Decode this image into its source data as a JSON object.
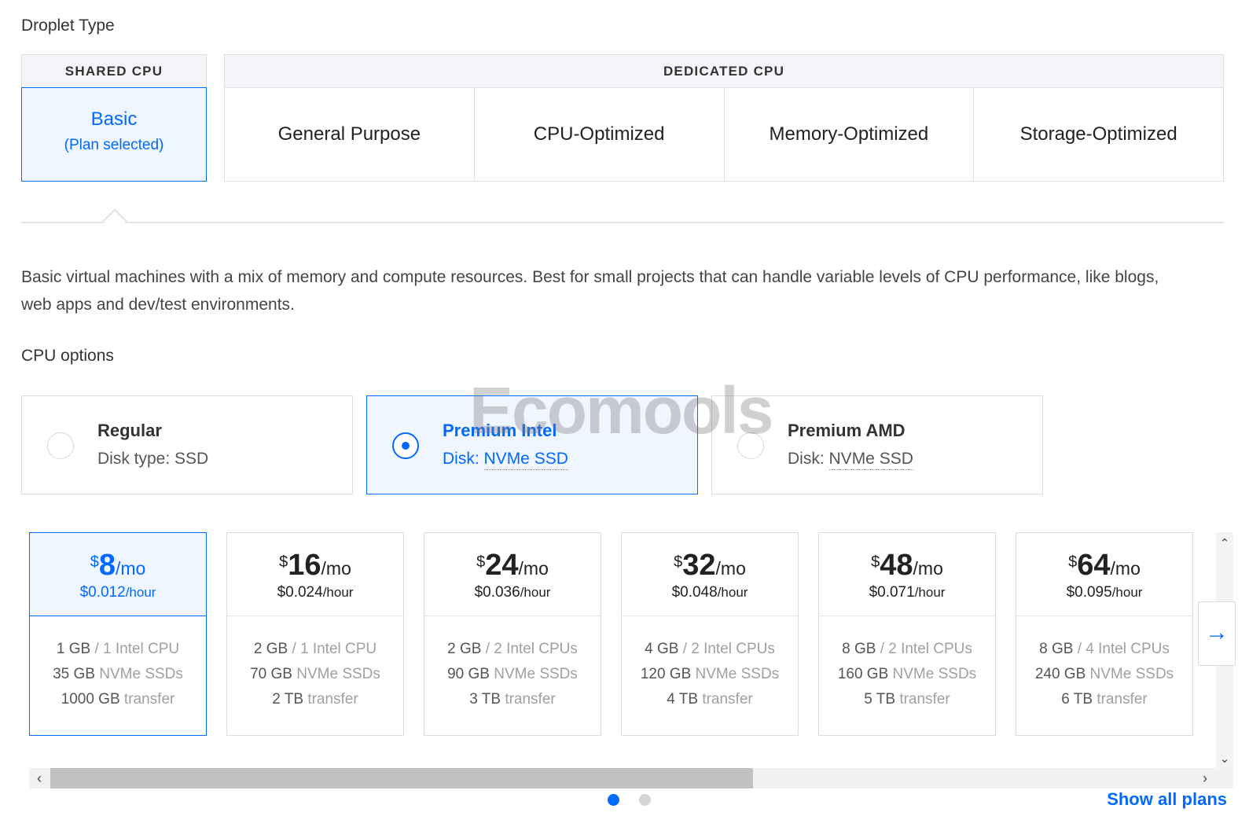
{
  "droplet_type": {
    "title": "Droplet Type",
    "shared": {
      "header": "SHARED CPU",
      "basic": {
        "name": "Basic",
        "status": "(Plan selected)"
      }
    },
    "dedicated": {
      "header": "DEDICATED CPU",
      "items": [
        "General Purpose",
        "CPU-Optimized",
        "Memory-Optimized",
        "Storage-Optimized"
      ]
    }
  },
  "description": "Basic virtual machines with a mix of memory and compute resources. Best for small projects that can handle variable levels of CPU performance, like blogs, web apps and dev/test environments.",
  "cpu_options": {
    "title": "CPU options",
    "items": [
      {
        "name": "Regular",
        "disk_label": "Disk type:",
        "disk_value": "SSD",
        "selected": false
      },
      {
        "name": "Premium Intel",
        "disk_label": "Disk:",
        "disk_value": "NVMe SSD",
        "selected": true
      },
      {
        "name": "Premium AMD",
        "disk_label": "Disk:",
        "disk_value": "NVMe SSD",
        "selected": false
      }
    ]
  },
  "watermark": "Ecomools",
  "plans": [
    {
      "currency": "$",
      "amount": "8",
      "per": "/mo",
      "hourly": "$0.012",
      "hourly_unit": "/hour",
      "mem": "1 GB",
      "cpu": "/ 1 Intel CPU",
      "disk": "35 GB",
      "disk_type": "NVMe SSDs",
      "transfer": "1000 GB",
      "transfer_label": "transfer",
      "selected": true
    },
    {
      "currency": "$",
      "amount": "16",
      "per": "/mo",
      "hourly": "$0.024",
      "hourly_unit": "/hour",
      "mem": "2 GB",
      "cpu": "/ 1 Intel CPU",
      "disk": "70 GB",
      "disk_type": "NVMe SSDs",
      "transfer": "2 TB",
      "transfer_label": "transfer",
      "selected": false
    },
    {
      "currency": "$",
      "amount": "24",
      "per": "/mo",
      "hourly": "$0.036",
      "hourly_unit": "/hour",
      "mem": "2 GB",
      "cpu": "/ 2 Intel CPUs",
      "disk": "90 GB",
      "disk_type": "NVMe SSDs",
      "transfer": "3 TB",
      "transfer_label": "transfer",
      "selected": false
    },
    {
      "currency": "$",
      "amount": "32",
      "per": "/mo",
      "hourly": "$0.048",
      "hourly_unit": "/hour",
      "mem": "4 GB",
      "cpu": "/ 2 Intel CPUs",
      "disk": "120 GB",
      "disk_type": "NVMe SSDs",
      "transfer": "4 TB",
      "transfer_label": "transfer",
      "selected": false
    },
    {
      "currency": "$",
      "amount": "48",
      "per": "/mo",
      "hourly": "$0.071",
      "hourly_unit": "/hour",
      "mem": "8 GB",
      "cpu": "/ 2 Intel CPUs",
      "disk": "160 GB",
      "disk_type": "NVMe SSDs",
      "transfer": "5 TB",
      "transfer_label": "transfer",
      "selected": false
    },
    {
      "currency": "$",
      "amount": "64",
      "per": "/mo",
      "hourly": "$0.095",
      "hourly_unit": "/hour",
      "mem": "8 GB",
      "cpu": "/ 4 Intel CPUs",
      "disk": "240 GB",
      "disk_type": "NVMe SSDs",
      "transfer": "6 TB",
      "transfer_label": "transfer",
      "selected": false
    }
  ],
  "icons": {
    "next": "arrow-right-icon",
    "scroll_up": "chevron-up-icon",
    "scroll_down": "chevron-down-icon",
    "scroll_left": "chevron-left-icon",
    "scroll_right": "chevron-right-icon"
  },
  "pager": {
    "pages": 2,
    "current": 1
  },
  "show_all_label": "Show all plans",
  "colors": {
    "accent": "#0069ff",
    "selected_bg": "#f0f6ff",
    "border": "#dcdcdc"
  }
}
